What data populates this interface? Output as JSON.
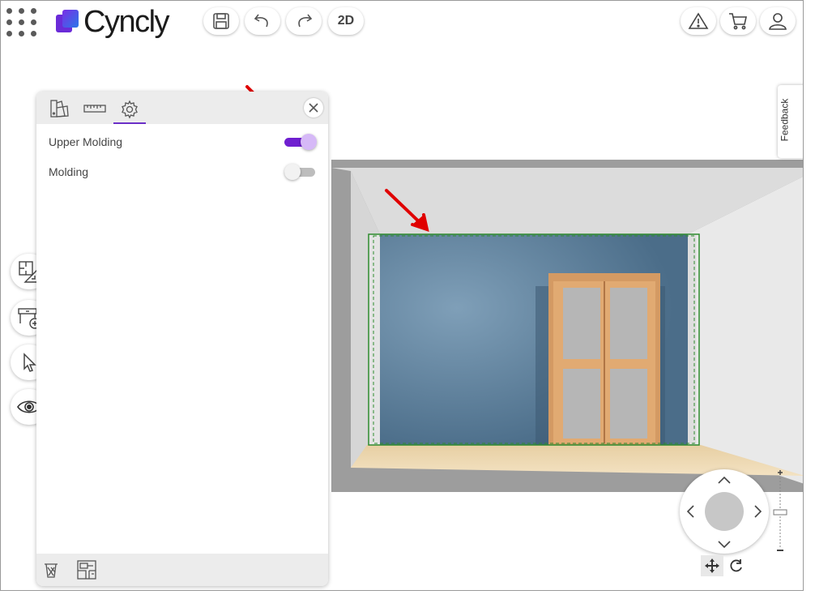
{
  "app": {
    "brand": "Cyncly",
    "brand_color": "#6f1fd0"
  },
  "toolbar": {
    "apps_icon": "grid-dots-icon",
    "save_icon": "save-icon",
    "undo_icon": "undo-icon",
    "redo_icon": "redo-icon",
    "view_toggle_label": "2D",
    "warning_icon": "warning-icon",
    "cart_icon": "cart-icon",
    "user_icon": "user-icon"
  },
  "side_tools": [
    {
      "name": "floorplan-measure-icon"
    },
    {
      "name": "add-furniture-icon"
    },
    {
      "name": "select-pointer-icon"
    },
    {
      "name": "visibility-eye-icon"
    }
  ],
  "panel": {
    "tabs": [
      {
        "name": "materials-swatch-icon",
        "active": false
      },
      {
        "name": "ruler-icon",
        "active": false
      },
      {
        "name": "settings-gear-icon",
        "active": true
      }
    ],
    "options": [
      {
        "label": "Upper Molding",
        "enabled": true
      },
      {
        "label": "Molding",
        "enabled": false
      }
    ],
    "footer_icons": [
      "delete-bin-icon",
      "floorplan-layout-icon"
    ]
  },
  "feedback": {
    "label": "Feedback"
  },
  "navigation": {
    "modes": [
      "pan-move-icon",
      "rotate-icon"
    ]
  },
  "scene": {
    "wall_color": "#4d6f8c",
    "floor_color": "#ecd5a8",
    "door_color": "#d9a06a",
    "selection_color": "#2e8b2e",
    "annotation_color": "#e00000"
  }
}
